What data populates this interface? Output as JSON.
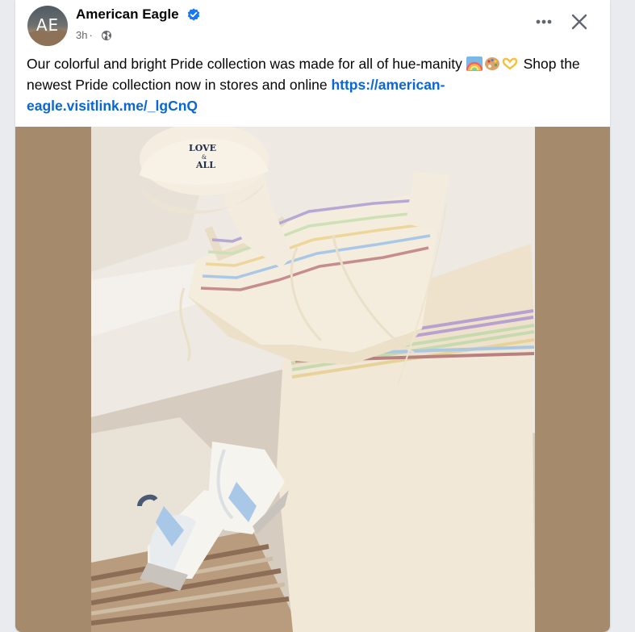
{
  "post": {
    "author": "American Eagle",
    "avatar_text": "AE",
    "time": "3h",
    "separator": "·",
    "text_before": "Our colorful and bright Pride collection was made for all of hue-manity",
    "text_after": "Shop the newest Pride collection now in stores and online",
    "link": "https://american-eagle.visitlink.me/_lgCnQ",
    "emojis": [
      "rainbow-emoji",
      "artist-palette-emoji",
      "heart-hands-emoji"
    ],
    "image_text": [
      "LOVE",
      "&",
      "ALL"
    ]
  },
  "colors": {
    "link": "#0a66d6",
    "verified": "#1877f2",
    "photo_border": "#a58a6c"
  }
}
